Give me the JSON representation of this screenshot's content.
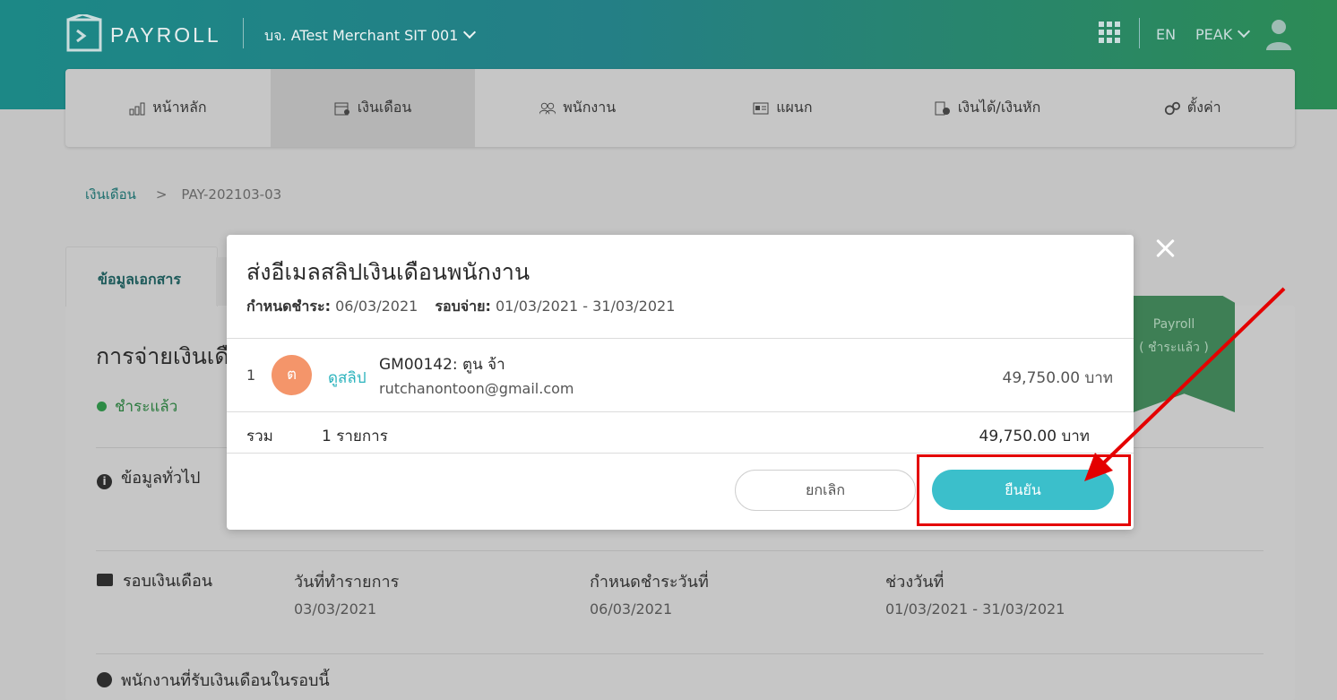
{
  "header": {
    "brand": "PAYROLL",
    "company": "บจ. ATest Merchant SIT 001",
    "lang": "EN",
    "user": "PEAK"
  },
  "nav": [
    {
      "label": "หน้าหลัก",
      "icon": "bar-chart-icon"
    },
    {
      "label": "เงินเดือน",
      "icon": "calendar-money-icon"
    },
    {
      "label": "พนักงาน",
      "icon": "users-icon"
    },
    {
      "label": "แผนก",
      "icon": "id-card-icon"
    },
    {
      "label": "เงินได้/เงินหัก",
      "icon": "coins-icon"
    },
    {
      "label": "ตั้งค่า",
      "icon": "gears-icon"
    }
  ],
  "breadcrumb": {
    "parent": "เงินเดือน",
    "current": "PAY-202103-03"
  },
  "page": {
    "tab": "ข้อมูลเอกสาร",
    "title": "การจ่ายเงินเดื",
    "status": "ชำระแล้ว",
    "ribbon_line1": "Payroll",
    "ribbon_line2": "( ชำระแล้ว )",
    "general_section": "ข้อมูลทั่วไป",
    "round_section": "รอบเงินเดือน",
    "fields": [
      {
        "label": "วันที่ทำรายการ",
        "value": "03/03/2021"
      },
      {
        "label": "กำหนดชำระวันที่",
        "value": "06/03/2021"
      },
      {
        "label": "ช่วงวันที่",
        "value": "01/03/2021 - 31/03/2021"
      }
    ],
    "employee_section": "พนักงานที่รับเงินเดือนในรอบนี้"
  },
  "modal": {
    "title": "ส่งอีเมลสลิปเงินเดือนพนักงาน",
    "due_label": "กำหนดชำระ:",
    "due_value": "06/03/2021",
    "period_label": "รอบจ่าย:",
    "period_value": "01/03/2021 - 31/03/2021",
    "rows": [
      {
        "no": "1",
        "avatar": "ต",
        "slip_link": "ดูสลิป",
        "employee": "GM00142: ตูน จ้า",
        "email": "rutchanontoon@gmail.com",
        "amount": "49,750.00 บาท"
      }
    ],
    "total_label": "รวม",
    "total_count": "1 รายการ",
    "total_amount": "49,750.00 บาท",
    "cancel_label": "ยกเลิก",
    "confirm_label": "ยืนยัน"
  },
  "colors": {
    "accent": "#3bbfcb",
    "highlight": "#e40000",
    "header": "#1c8886"
  }
}
